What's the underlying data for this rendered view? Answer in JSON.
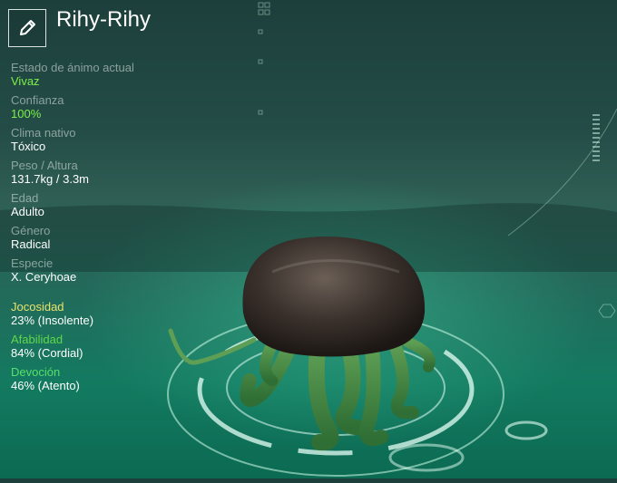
{
  "header": {
    "creature_name": "Rihy-Rihy",
    "edit_icon": "pencil-icon"
  },
  "stats": [
    {
      "label": "Estado de ánimo actual",
      "value": "Vivaz",
      "highlight": true
    },
    {
      "label": "Confianza",
      "value": "100%",
      "highlight": true
    },
    {
      "label": "Clima nativo",
      "value": "Tóxico",
      "highlight": false
    },
    {
      "label": "Peso / Altura",
      "value": "131.7kg / 3.3m",
      "highlight": false
    },
    {
      "label": "Edad",
      "value": "Adulto",
      "highlight": false
    },
    {
      "label": "Género",
      "value": "Radical",
      "highlight": false
    },
    {
      "label": "Especie",
      "value": "X. Ceryhoae",
      "highlight": false
    }
  ],
  "traits": [
    {
      "label": "Jocosidad",
      "value": "23% (Insolente)",
      "color": "#e8e26a"
    },
    {
      "label": "Afabilidad",
      "value": "84% (Cordial)",
      "color": "#5fd84a"
    },
    {
      "label": "Devoción",
      "value": "46% (Atento)",
      "color": "#56e06a"
    }
  ],
  "colors": {
    "accent_green": "#7cf04a",
    "mood_value": "#7cf04a",
    "label_gray": "#aab6b4"
  }
}
